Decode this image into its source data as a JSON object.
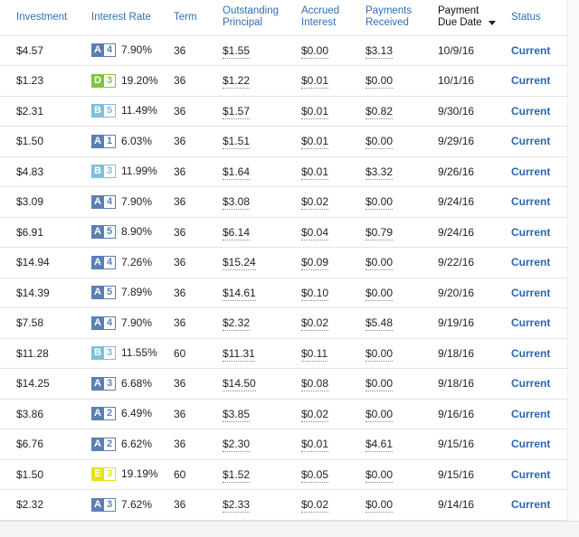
{
  "headers": {
    "investment": "Investment",
    "interest_rate": "Interest Rate",
    "term": "Term",
    "outstanding_1": "Outstanding",
    "outstanding_2": "Principal",
    "accrued_1": "Accrued",
    "accrued_2": "Interest",
    "payments_1": "Payments",
    "payments_2": "Received",
    "due_1": "Payment",
    "due_2": "Due Date",
    "status": "Status"
  },
  "grade_colors": {
    "A": "#5b7fb3",
    "B": "#7ec0d9",
    "D": "#7fc544",
    "E": "#e3e31c"
  },
  "rows": [
    {
      "investment": "$4.57",
      "grade": "A",
      "sub": "4",
      "rate": "7.90%",
      "term": "36",
      "outstanding": "$1.55",
      "accrued": "$0.00",
      "received": "$3.13",
      "due": "10/9/16",
      "status": "Current"
    },
    {
      "investment": "$1.23",
      "grade": "D",
      "sub": "3",
      "rate": "19.20%",
      "term": "36",
      "outstanding": "$1.22",
      "accrued": "$0.01",
      "received": "$0.00",
      "due": "10/1/16",
      "status": "Current"
    },
    {
      "investment": "$2.31",
      "grade": "B",
      "sub": "5",
      "rate": "11.49%",
      "term": "36",
      "outstanding": "$1.57",
      "accrued": "$0.01",
      "received": "$0.82",
      "due": "9/30/16",
      "status": "Current"
    },
    {
      "investment": "$1.50",
      "grade": "A",
      "sub": "1",
      "rate": "6.03%",
      "term": "36",
      "outstanding": "$1.51",
      "accrued": "$0.01",
      "received": "$0.00",
      "due": "9/29/16",
      "status": "Current"
    },
    {
      "investment": "$4.83",
      "grade": "B",
      "sub": "3",
      "rate": "11.99%",
      "term": "36",
      "outstanding": "$1.64",
      "accrued": "$0.01",
      "received": "$3.32",
      "due": "9/26/16",
      "status": "Current"
    },
    {
      "investment": "$3.09",
      "grade": "A",
      "sub": "4",
      "rate": "7.90%",
      "term": "36",
      "outstanding": "$3.08",
      "accrued": "$0.02",
      "received": "$0.00",
      "due": "9/24/16",
      "status": "Current"
    },
    {
      "investment": "$6.91",
      "grade": "A",
      "sub": "5",
      "rate": "8.90%",
      "term": "36",
      "outstanding": "$6.14",
      "accrued": "$0.04",
      "received": "$0.79",
      "due": "9/24/16",
      "status": "Current"
    },
    {
      "investment": "$14.94",
      "grade": "A",
      "sub": "4",
      "rate": "7.26%",
      "term": "36",
      "outstanding": "$15.24",
      "accrued": "$0.09",
      "received": "$0.00",
      "due": "9/22/16",
      "status": "Current"
    },
    {
      "investment": "$14.39",
      "grade": "A",
      "sub": "5",
      "rate": "7.89%",
      "term": "36",
      "outstanding": "$14.61",
      "accrued": "$0.10",
      "received": "$0.00",
      "due": "9/20/16",
      "status": "Current"
    },
    {
      "investment": "$7.58",
      "grade": "A",
      "sub": "4",
      "rate": "7.90%",
      "term": "36",
      "outstanding": "$2.32",
      "accrued": "$0.02",
      "received": "$5.48",
      "due": "9/19/16",
      "status": "Current"
    },
    {
      "investment": "$11.28",
      "grade": "B",
      "sub": "3",
      "rate": "11.55%",
      "term": "60",
      "outstanding": "$11.31",
      "accrued": "$0.11",
      "received": "$0.00",
      "due": "9/18/16",
      "status": "Current"
    },
    {
      "investment": "$14.25",
      "grade": "A",
      "sub": "3",
      "rate": "6.68%",
      "term": "36",
      "outstanding": "$14.50",
      "accrued": "$0.08",
      "received": "$0.00",
      "due": "9/18/16",
      "status": "Current"
    },
    {
      "investment": "$3.86",
      "grade": "A",
      "sub": "2",
      "rate": "6.49%",
      "term": "36",
      "outstanding": "$3.85",
      "accrued": "$0.02",
      "received": "$0.00",
      "due": "9/16/16",
      "status": "Current"
    },
    {
      "investment": "$6.76",
      "grade": "A",
      "sub": "2",
      "rate": "6.62%",
      "term": "36",
      "outstanding": "$2.30",
      "accrued": "$0.01",
      "received": "$4.61",
      "due": "9/15/16",
      "status": "Current"
    },
    {
      "investment": "$1.50",
      "grade": "E",
      "sub": "3",
      "rate": "19.19%",
      "term": "60",
      "outstanding": "$1.52",
      "accrued": "$0.05",
      "received": "$0.00",
      "due": "9/15/16",
      "status": "Current"
    },
    {
      "investment": "$2.32",
      "grade": "A",
      "sub": "3",
      "rate": "7.62%",
      "term": "36",
      "outstanding": "$2.33",
      "accrued": "$0.02",
      "received": "$0.00",
      "due": "9/14/16",
      "status": "Current"
    }
  ]
}
